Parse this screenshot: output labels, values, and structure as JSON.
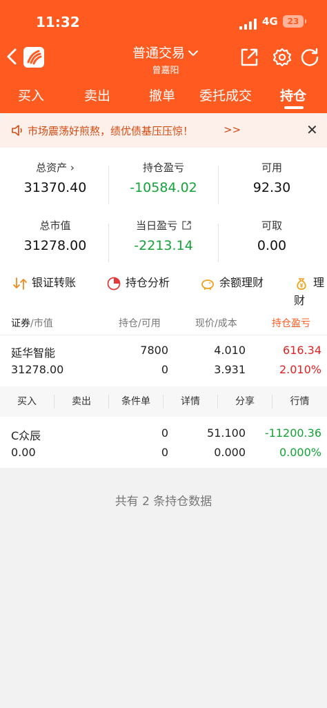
{
  "status": {
    "time": "11:32",
    "network": "4G",
    "battery": "23"
  },
  "header": {
    "title": "普通交易",
    "subtitle": "曾嘉阳",
    "tabs": [
      {
        "label": "买入"
      },
      {
        "label": "卖出"
      },
      {
        "label": "撤单"
      },
      {
        "label": "委托成交"
      },
      {
        "label": "持仓"
      }
    ]
  },
  "notice": {
    "text": "市场震荡好煎熬，绩优债基压压惊！",
    "more": ">>",
    "close": "✕"
  },
  "summary": {
    "total_assets": {
      "label": "总资产",
      "value": "31370.40"
    },
    "position_pl": {
      "label": "持仓盈亏",
      "value": "-10584.02"
    },
    "available": {
      "label": "可用",
      "value": "92.30"
    },
    "market_value": {
      "label": "总市值",
      "value": "31278.00"
    },
    "daily_pl": {
      "label": "当日盈亏",
      "value": "-2213.14"
    },
    "withdrawable": {
      "label": "可取",
      "value": "0.00"
    }
  },
  "actions": [
    {
      "label": "银证转账",
      "icon": "transfer-icon"
    },
    {
      "label": "持仓分析",
      "icon": "pie-chart-icon"
    },
    {
      "label": "余额理财",
      "icon": "piggy-bank-icon"
    },
    {
      "label": "理财",
      "icon": "money-bag-icon"
    }
  ],
  "holdings_header": {
    "c1a": "证券",
    "c1b": "/市值",
    "c2a": "持仓",
    "c2b": "/可用",
    "c3a": "现价",
    "c3b": "/成本",
    "c4": "持仓盈亏"
  },
  "holdings": [
    {
      "name": "延华智能",
      "market_value": "31278.00",
      "position": "7800",
      "available": "0",
      "price": "4.010",
      "cost": "3.931",
      "pl": "616.34",
      "pl_pct": "2.010%"
    },
    {
      "name": "C众辰",
      "market_value": "0.00",
      "position": "0",
      "available": "0",
      "price": "51.100",
      "cost": "0.000",
      "pl": "-11200.36",
      "pl_pct": "0.000%"
    }
  ],
  "row_ops": [
    "买入",
    "卖出",
    "条件单",
    "详情",
    "分享",
    "行情"
  ],
  "footer_note": "共有 2 条持仓数据",
  "colors": {
    "brand": "#ff5a1f",
    "gain": "#e02020",
    "loss": "#12a336"
  }
}
